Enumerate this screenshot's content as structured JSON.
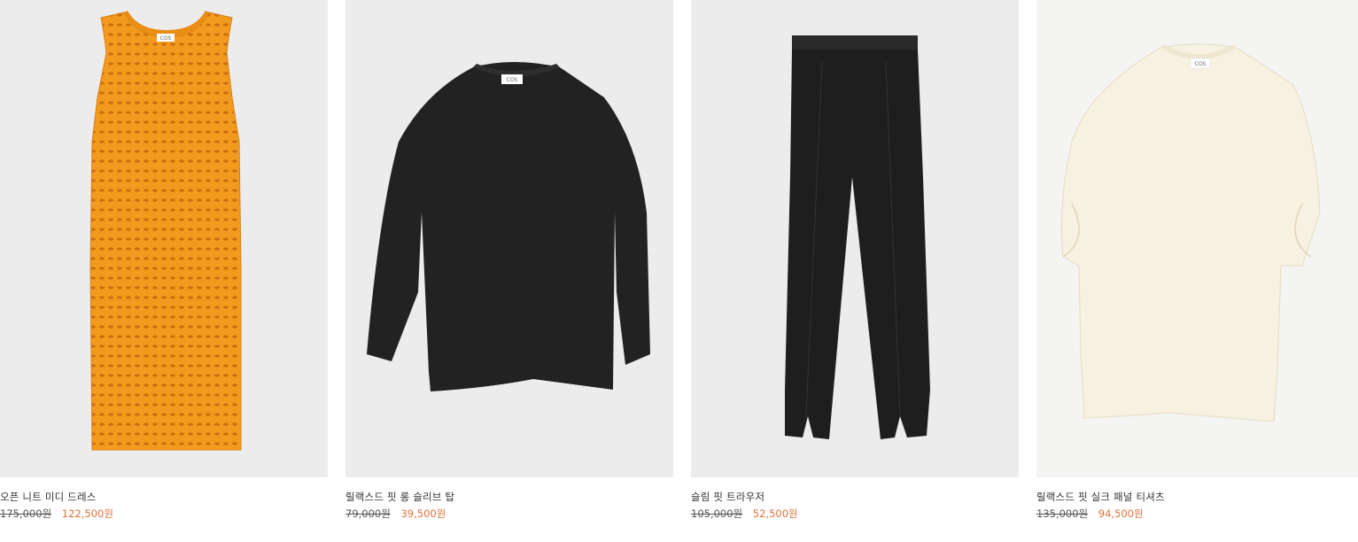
{
  "products": [
    {
      "name": "오픈 니트 미디 드레스",
      "original_price": "175,000원",
      "sale_price": "122,500원",
      "image": "orange-knit-dress-image",
      "color": "#f39a1e",
      "tag": "COS"
    },
    {
      "name": "릴랙스드 핏 롱 슬리브 탑",
      "original_price": "79,000원",
      "sale_price": "39,500원",
      "image": "black-long-sleeve-top-image",
      "color": "#222222",
      "tag": "COS"
    },
    {
      "name": "슬림 핏 트라우저",
      "original_price": "105,000원",
      "sale_price": "52,500원",
      "image": "black-slim-trousers-image",
      "color": "#1e1e1e",
      "tag": ""
    },
    {
      "name": "릴랙스드 핏 실크 패널 티셔츠",
      "original_price": "135,000원",
      "sale_price": "94,500원",
      "image": "cream-silk-panel-tshirt-image",
      "color": "#f7f1e1",
      "tag": "COS"
    }
  ],
  "colors": {
    "image_background": "#ececec",
    "sale_price": "#e0723a",
    "text": "#333333"
  }
}
